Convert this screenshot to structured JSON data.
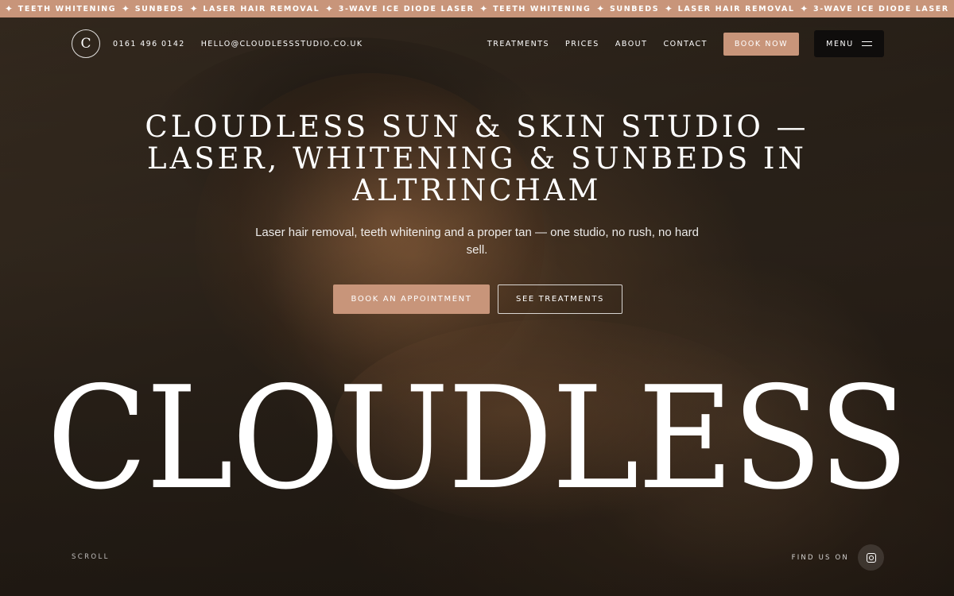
{
  "ticker": {
    "items": [
      "Teeth Whitening",
      "Sunbeds",
      "Laser Hair Removal",
      "3-Wave Ice Diode Laser",
      "Teeth Whitening",
      "Sunbeds",
      "Laser Hair Removal",
      "3-Wave Ice Diode Laser"
    ],
    "separator": "✦"
  },
  "header": {
    "logo_letter": "C",
    "phone": "0161 496 0142",
    "email": "hello@cloudlessstudio.co.uk",
    "nav": [
      "Treatments",
      "Prices",
      "About",
      "Contact"
    ],
    "book_now": "Book Now",
    "menu": "Menu"
  },
  "hero": {
    "title": "Cloudless Sun & Skin Studio — Laser, Whitening & Sunbeds in Altrincham",
    "subtitle": "Laser hair removal, teeth whitening and a proper tan — one studio, no rush, no hard sell.",
    "primary_cta": "Book an appointment",
    "secondary_cta": "See treatments",
    "wordmark": "CLOUDLESS"
  },
  "footer": {
    "scroll": "Scroll",
    "find_us": "Find us on",
    "social_icon": "instagram-icon"
  },
  "colors": {
    "accent": "#c8957a",
    "menu_bg": "#0f0d0c"
  }
}
